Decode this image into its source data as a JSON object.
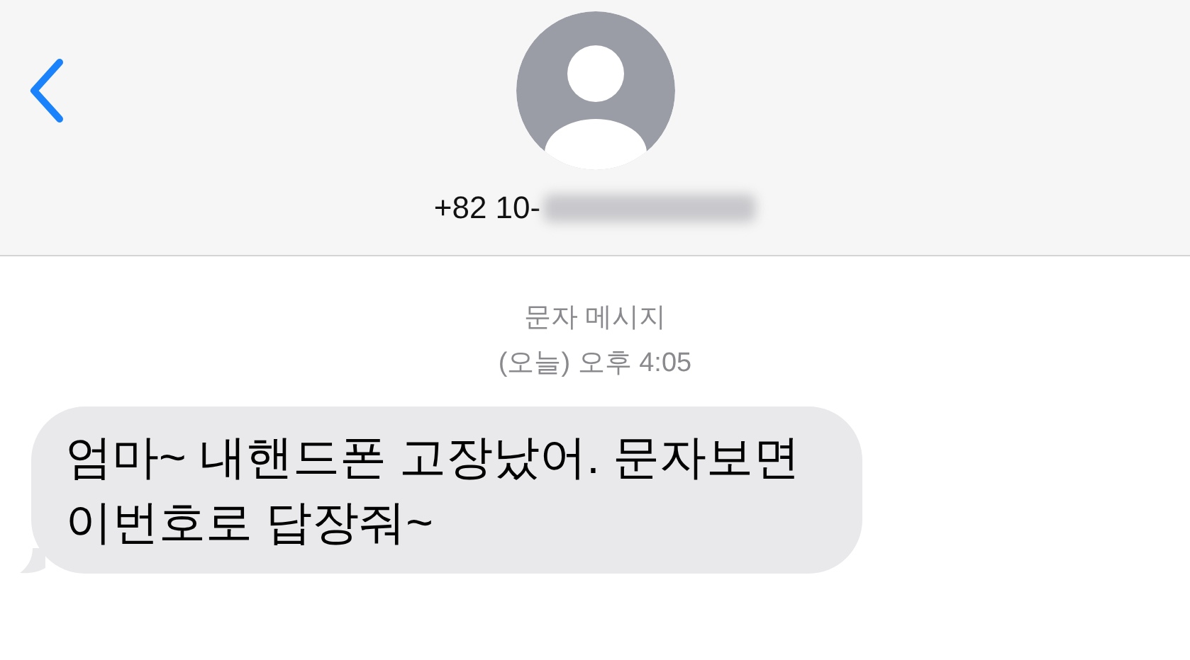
{
  "header": {
    "contact": "+82 10-"
  },
  "conversation": {
    "service": "문자 메시지",
    "timestamp": "(오늘) 오후 4:05"
  },
  "messages": [
    {
      "text": "엄마~ 내핸드폰 고장났어. 문자보면 이번호로 답장줘~",
      "kind": "incoming"
    }
  ]
}
